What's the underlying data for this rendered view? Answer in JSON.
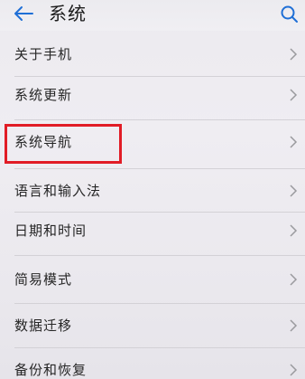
{
  "header": {
    "title": "系统",
    "back_icon": "back-arrow-icon",
    "search_icon": "search-icon"
  },
  "menu": {
    "items": [
      {
        "label": "关于手机"
      },
      {
        "label": "系统更新"
      },
      {
        "label": "系统导航"
      },
      {
        "label": "语言和输入法"
      },
      {
        "label": "日期和时间"
      },
      {
        "label": "简易模式"
      },
      {
        "label": "数据迁移"
      },
      {
        "label": "备份和恢复"
      }
    ],
    "chevron_icon": "chevron-right-icon"
  },
  "colors": {
    "accent_back": "#1f6fd6",
    "highlight": "#e11c26",
    "chevron": "#9a9a9e"
  }
}
